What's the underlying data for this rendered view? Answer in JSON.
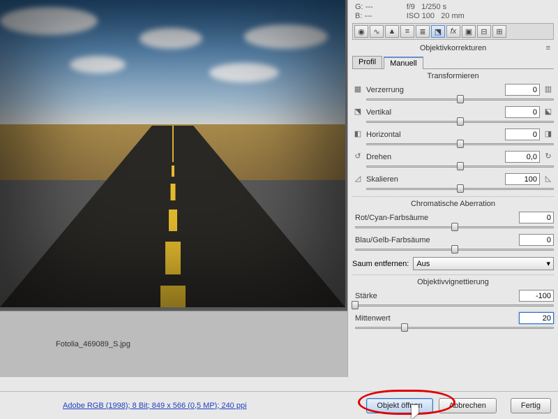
{
  "header": {
    "color_labels": {
      "g": "G:",
      "b": "B:",
      "g_val": "---",
      "b_val": "---"
    },
    "exposure": {
      "aperture": "f/9",
      "shutter": "1/250 s",
      "iso": "ISO 100",
      "focal": "20 mm"
    }
  },
  "panel": {
    "title": "Objektivkorrekturen",
    "tabs": {
      "profile": "Profil",
      "manual": "Manuell"
    }
  },
  "transform": {
    "title": "Transformieren",
    "distortion": {
      "label": "Verzerrung",
      "value": "0",
      "pos": 50
    },
    "vertical": {
      "label": "Vertikal",
      "value": "0",
      "pos": 50
    },
    "horizontal": {
      "label": "Horizontal",
      "value": "0",
      "pos": 50
    },
    "rotate": {
      "label": "Drehen",
      "value": "0,0",
      "pos": 50
    },
    "scale": {
      "label": "Skalieren",
      "value": "100",
      "pos": 50
    }
  },
  "chromatic": {
    "title": "Chromatische Aberration",
    "red_cyan": {
      "label": "Rot/Cyan-Farbsäume",
      "value": "0",
      "pos": 50
    },
    "blue_yellow": {
      "label": "Blau/Gelb-Farbsäume",
      "value": "0",
      "pos": 50
    },
    "defringe_label": "Saum entfernen:",
    "defringe_value": "Aus"
  },
  "vignette": {
    "title": "Objektivvignettierung",
    "amount": {
      "label": "Stärke",
      "value": "-100",
      "pos": 0
    },
    "midpoint": {
      "label": "Mittenwert",
      "value": "20",
      "pos": 25
    }
  },
  "filmstrip": {
    "filename": "Fotolia_469089_S.jpg"
  },
  "footer": {
    "link": "Adobe RGB (1998); 8 Bit; 849 x 566 (0,5 MP); 240 ppi",
    "open": "Objekt öffnen",
    "cancel": "Abbrechen",
    "done": "Fertig"
  },
  "icons": {
    "menu": "≡",
    "dropdown": "▾"
  }
}
